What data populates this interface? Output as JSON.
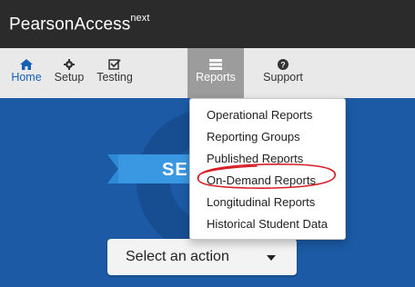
{
  "app": {
    "brand": "PearsonAccess",
    "brand_sup": "next"
  },
  "nav": {
    "items": [
      {
        "label": "Home",
        "icon": "home-icon"
      },
      {
        "label": "Setup",
        "icon": "gear-icon"
      },
      {
        "label": "Testing",
        "icon": "checkbox-icon"
      },
      {
        "label": "Reports",
        "icon": "reports-icon",
        "active": true
      },
      {
        "label": "Support",
        "icon": "question-icon"
      }
    ]
  },
  "reports_menu": {
    "items": [
      "Operational Reports",
      "Reporting Groups",
      "Published Reports",
      "On-Demand Reports",
      "Longitudinal Reports",
      "Historical Student Data"
    ],
    "circled_item": "On-Demand Reports"
  },
  "main": {
    "banner_text": "SE",
    "action_select": {
      "label": "Select an action"
    }
  },
  "colors": {
    "topbar": "#2b2b2b",
    "nav_active": "#9c9c9c",
    "home_blue": "#1560b6",
    "main_blue": "#1c5aa6",
    "ribbon_blue": "#3a97e2",
    "annotation_red": "#d81f26"
  }
}
